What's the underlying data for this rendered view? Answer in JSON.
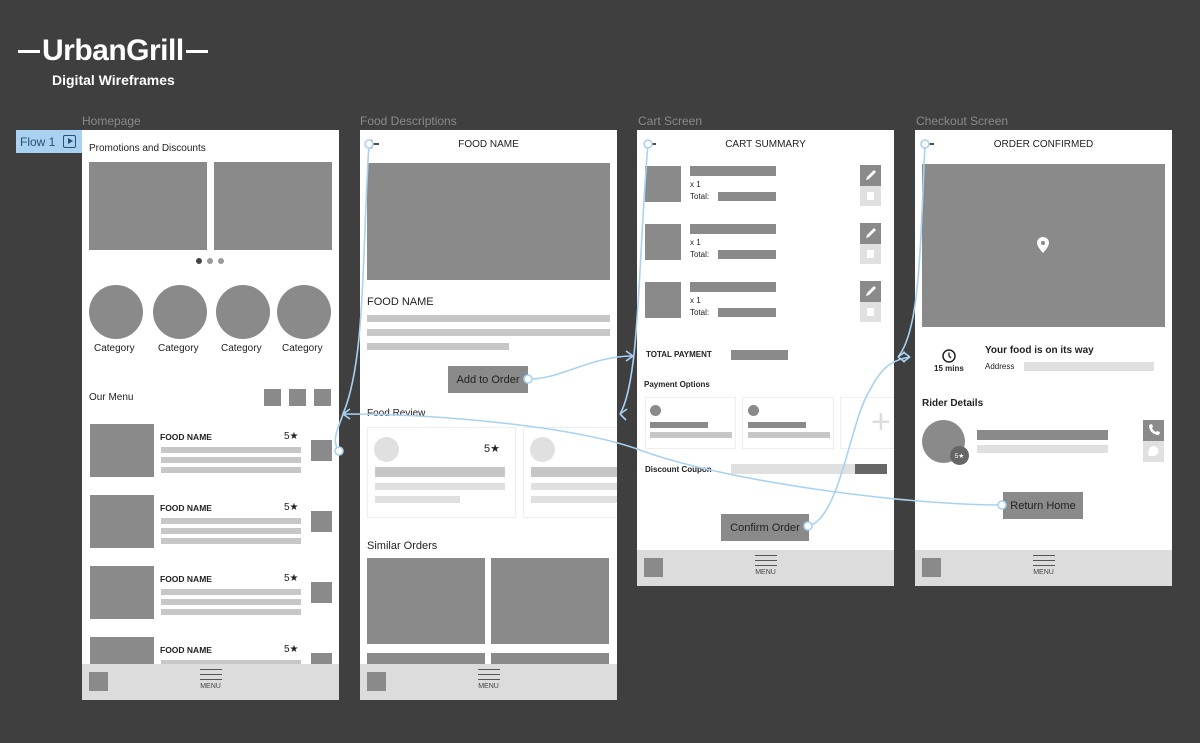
{
  "brand": {
    "name": "UrbanGrill",
    "subtitle": "Digital Wireframes"
  },
  "flow": {
    "label": "Flow 1",
    "icon": "play-flow-icon"
  },
  "frames": {
    "homepage": {
      "label": "Homepage",
      "promotions_title": "Promotions and Discounts",
      "carousel_dots": 3,
      "categories": [
        "Category",
        "Category",
        "Category",
        "Category"
      ],
      "menu_title": "Our Menu",
      "menu_items": [
        {
          "name": "FOOD NAME",
          "rating": "5★"
        },
        {
          "name": "FOOD NAME",
          "rating": "5★"
        },
        {
          "name": "FOOD NAME",
          "rating": "5★"
        },
        {
          "name": "FOOD NAME",
          "rating": "5★"
        }
      ],
      "nav_menu_label": "MENU"
    },
    "food": {
      "label": "Food Descriptions",
      "header_title": "FOOD NAME",
      "food_name": "FOOD NAME",
      "add_button": "Add to Order",
      "review_title": "Food Review",
      "review_rating": "5★",
      "similar_title": "Similar Orders",
      "nav_menu_label": "MENU"
    },
    "cart": {
      "label": "Cart Screen",
      "header_title": "CART SUMMARY",
      "items": [
        {
          "qty": "x 1",
          "total_label": "Total:"
        },
        {
          "qty": "x 1",
          "total_label": "Total:"
        },
        {
          "qty": "x 1",
          "total_label": "Total:"
        }
      ],
      "total_payment_label": "TOTAL PAYMENT",
      "payment_options_title": "Payment Options",
      "add_option_icon": "+",
      "discount_label": "Discount Coupon",
      "confirm_button": "Confirm Order",
      "nav_menu_label": "MENU"
    },
    "checkout": {
      "label": "Checkout Screen",
      "header_title": "ORDER CONFIRMED",
      "eta": "15 mins",
      "status_text": "Your food is on its way",
      "address_label": "Address",
      "rider_title": "Rider Details",
      "rider_rating": "5★",
      "return_button": "Return Home",
      "nav_menu_label": "MENU"
    }
  },
  "colors": {
    "background": "#3f3f3f",
    "placeholder": "#8a8a8a",
    "flow_line": "#a9d2f2",
    "flow_tag": "#a9d2f2"
  }
}
